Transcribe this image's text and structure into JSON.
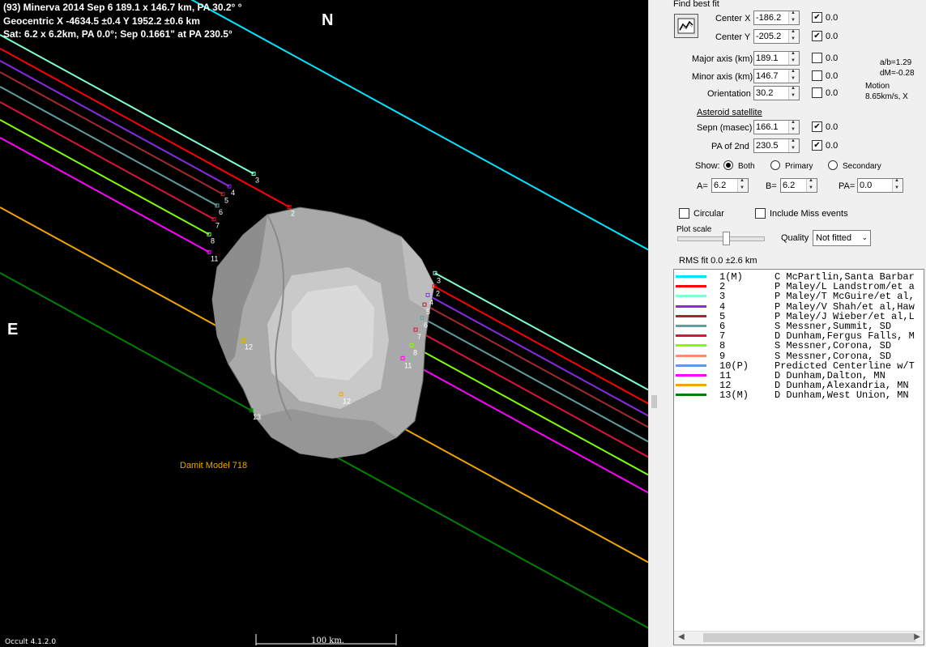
{
  "header": {
    "line1": "(93) Minerva  2014 Sep 6  189.1 x 146.7 km, PA 30.2° °",
    "line2": "Geocentric  X  -4634.5 ±0.4  Y 1952.2 ±0.6 km",
    "line3": "Sat: 6.2 x 6.2km, PA 0.0°; Sep 0.1661\" at PA 230.5°"
  },
  "directions": {
    "north": "N",
    "east": "E"
  },
  "model_label": "Damit Model 718",
  "version": "Occult 4.1.2.0",
  "scale_label": "100 km.",
  "chord_labels": {
    "left": [
      "2",
      "3",
      "4",
      "5",
      "6",
      "7",
      "8",
      "11",
      "12",
      "13"
    ],
    "right": [
      "2",
      "3",
      "4",
      "5",
      "6",
      "7",
      "8",
      "11",
      "12"
    ]
  },
  "panel": {
    "find_best_fit": "Find best fit",
    "center_x": {
      "label": "Center X",
      "value": "-186.2",
      "checked": true,
      "err": "0.0"
    },
    "center_y": {
      "label": "Center Y",
      "value": "-205.2",
      "checked": true,
      "err": "0.0"
    },
    "major_axis": {
      "label": "Major axis (km)",
      "value": "189.1",
      "checked": false,
      "err": "0.0"
    },
    "minor_axis": {
      "label": "Minor axis (km)",
      "value": "146.7",
      "checked": false,
      "err": "0.0"
    },
    "orientation": {
      "label": "Orientation",
      "value": "30.2",
      "checked": false,
      "err": "0.0"
    },
    "ab_ratio": "a/b=1.29",
    "dm": "dM=-0.28",
    "motion_label": "Motion",
    "motion_value": "8.65km/s, X",
    "satellite_heading": "Asteroid satellite",
    "sepn": {
      "label": "Sepn (masec)",
      "value": "166.1",
      "checked": true,
      "err": "0.0"
    },
    "pa_2nd": {
      "label": "PA of 2nd",
      "value": "230.5",
      "checked": true,
      "err": "0.0"
    },
    "show_label": "Show:",
    "show_options": [
      "Both",
      "Primary",
      "Secondary"
    ],
    "show_selected": "Both",
    "a_label": "A=",
    "a_value": "6.2",
    "b_label": "B=",
    "b_value": "6.2",
    "pa_label": "PA=",
    "pa_value": "0.0",
    "circular_label": "Circular",
    "include_miss_label": "Include Miss events",
    "plot_scale_label": "Plot scale",
    "plot_scale_level": 0.55,
    "quality_label": "Quality",
    "quality_value": "Not fitted",
    "rms_fit": "RMS fit 0.0 ±2.6 km"
  },
  "observers": [
    {
      "id": "1(M)",
      "name": "C McPartlin,Santa Barbar",
      "color": "#00e5ff"
    },
    {
      "id": "2",
      "name": "P Maley/L Landstrom/et a",
      "color": "#ff0000"
    },
    {
      "id": "3",
      "name": "P Maley/T McGuire/et al,",
      "color": "#7fffd4"
    },
    {
      "id": "4",
      "name": "P Maley/V Shah/et al,Haw",
      "color": "#8a2be2"
    },
    {
      "id": "5",
      "name": "P Maley/J Wieber/et al,L",
      "color": "#a52a2a"
    },
    {
      "id": "6",
      "name": "S Messner,Summit, SD",
      "color": "#5f9ea0"
    },
    {
      "id": "7",
      "name": "D Dunham,Fergus Falls, M",
      "color": "#dc143c"
    },
    {
      "id": "8",
      "name": "S Messner,Corona, SD",
      "color": "#7fff00"
    },
    {
      "id": "9",
      "name": "S Messner,Corona, SD",
      "color": "#ff8c69"
    },
    {
      "id": "10(P)",
      "name": "Predicted Centerline w/T",
      "color": "#6495ed"
    },
    {
      "id": "11",
      "name": "D Dunham,Dalton, MN",
      "color": "#ff00ff"
    },
    {
      "id": "12",
      "name": "D Dunham,Alexandria, MN",
      "color": "#f0a500"
    },
    {
      "id": "13(M)",
      "name": "D Dunham,West Union, MN",
      "color": "#008000"
    }
  ]
}
